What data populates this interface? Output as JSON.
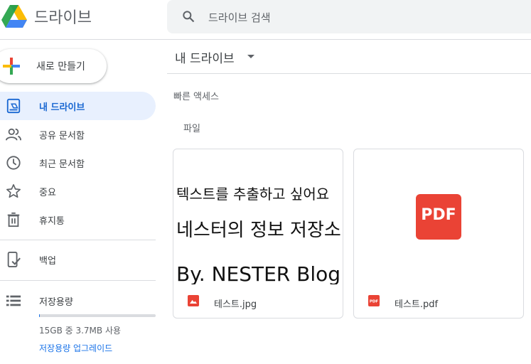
{
  "header": {
    "app_title": "드라이브",
    "search_placeholder": "드라이브 검색"
  },
  "sidebar": {
    "new_label": "새로 만들기",
    "items": [
      {
        "label": "내 드라이브",
        "icon": "my-drive-icon",
        "active": true
      },
      {
        "label": "공유 문서함",
        "icon": "people-icon"
      },
      {
        "label": "최근 문서함",
        "icon": "clock-icon"
      },
      {
        "label": "중요",
        "icon": "star-icon"
      },
      {
        "label": "휴지통",
        "icon": "trash-icon"
      },
      {
        "label": "백업",
        "icon": "backup-icon"
      },
      {
        "label": "저장용량",
        "icon": "storage-icon"
      }
    ],
    "storage": {
      "used_text": "15GB 중 3.7MB 사용",
      "used_fraction": 0.0002,
      "upgrade_label": "저장용량 업그레이드"
    }
  },
  "main": {
    "title": "내 드라이브",
    "quick_access_label": "빠른 액세스",
    "files_label": "파일",
    "files": [
      {
        "name": "테스트.jpg",
        "icon": "image-icon",
        "preview_lines": [
          "텍스트를 추출하고 싶어요",
          "네스터의 정보 저장소",
          "By. NESTER Blog"
        ]
      },
      {
        "name": "테스트.pdf",
        "icon": "pdf-icon",
        "preview_badge": "PDF"
      }
    ]
  },
  "colors": {
    "accent": "#1a73e8",
    "active_bg": "#e8f0fe",
    "pdf_red": "#ea4335",
    "divider": "#dadce0"
  }
}
